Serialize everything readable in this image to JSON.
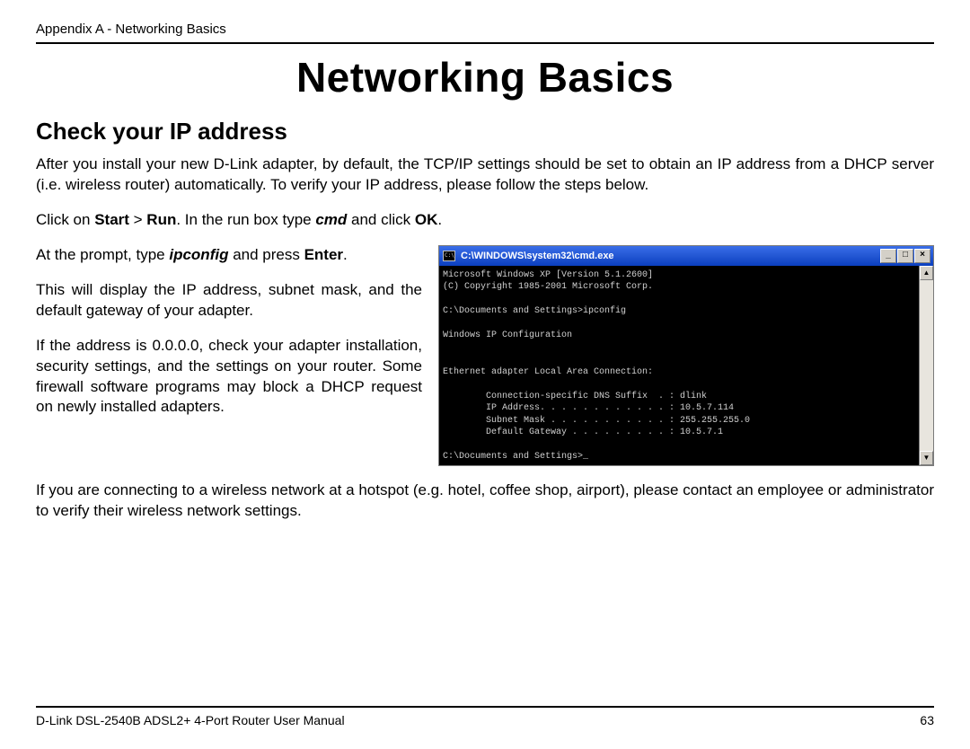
{
  "header": {
    "appendix": "Appendix A - Networking Basics"
  },
  "page_title": "Networking Basics",
  "section_title": "Check your IP address",
  "intro": "After you install your new D-Link adapter, by default, the TCP/IP settings should be set to obtain an IP address from a DHCP server (i.e. wireless router) automatically. To verify your IP address, please follow the steps below.",
  "step1": {
    "t1": "Click on ",
    "b1": "Start",
    "t2": " > ",
    "b2": "Run",
    "t3": ". In the run box type ",
    "bi1": "cmd",
    "t4": " and click ",
    "b3": "OK",
    "t5": "."
  },
  "left": {
    "p1a": "At the prompt, type ",
    "p1bi": "ipconfig",
    "p1b": " and press ",
    "p1bold": "Enter",
    "p1c": ".",
    "p2": "This will display the IP address, subnet mask, and the default gateway of your adapter.",
    "p3": "If the address is 0.0.0.0, check your adapter installation, security settings, and the settings on your router. Some firewall software programs may block a DHCP request on newly installed adapters."
  },
  "bottom_para": "If you are connecting to a wireless network at a hotspot (e.g. hotel, coffee shop, airport), please contact an employee or administrator to verify their wireless network settings.",
  "cmd": {
    "title": "C:\\WINDOWS\\system32\\cmd.exe",
    "btn_min": "_",
    "btn_max": "□",
    "btn_close": "×",
    "sb_up": "▲",
    "sb_down": "▼",
    "lines": "Microsoft Windows XP [Version 5.1.2600]\n(C) Copyright 1985-2001 Microsoft Corp.\n\nC:\\Documents and Settings>ipconfig\n\nWindows IP Configuration\n\n\nEthernet adapter Local Area Connection:\n\n        Connection-specific DNS Suffix  . : dlink\n        IP Address. . . . . . . . . . . . : 10.5.7.114\n        Subnet Mask . . . . . . . . . . . : 255.255.255.0\n        Default Gateway . . . . . . . . . : 10.5.7.1\n\nC:\\Documents and Settings>_"
  },
  "footer": {
    "manual": "D-Link DSL-2540B ADSL2+ 4-Port Router User Manual",
    "page": "63"
  }
}
